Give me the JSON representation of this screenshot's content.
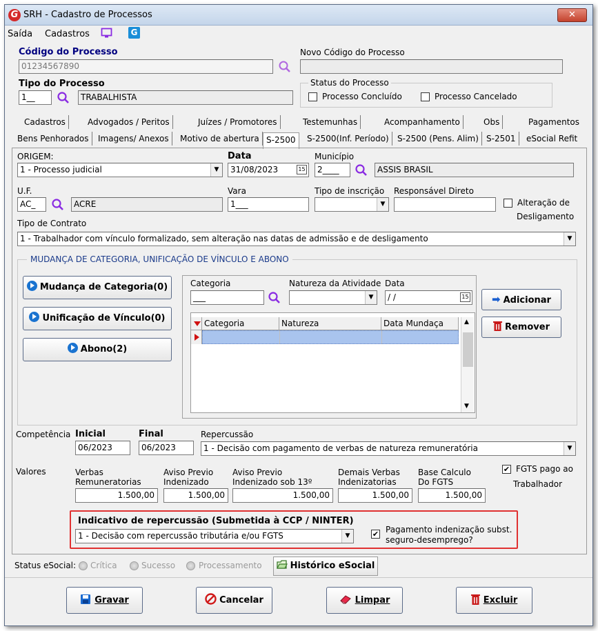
{
  "window": {
    "title": "SRH - Cadastro de Processos",
    "close_glyph": "✕",
    "logo_letter": "G"
  },
  "menu": {
    "saida": "Saída",
    "cadastros": "Cadastros",
    "icons": [
      "monitor-icon",
      "app-logo-icon"
    ]
  },
  "header": {
    "codigo_label": "Código do Processo",
    "codigo_value": "01234567890",
    "novo_codigo_label": "Novo Código do Processo",
    "novo_codigo_value": "",
    "tipo_label": "Tipo do Processo",
    "tipo_code": "1__",
    "tipo_desc": "TRABALHISTA",
    "status_label": "Status do Processo",
    "status_concluido": "Processo Concluído",
    "status_cancelado": "Processo Cancelado"
  },
  "tabs": {
    "row1": [
      "Cadastros",
      "Advogados / Peritos",
      "Juízes / Promotores",
      "Testemunhas",
      "Acompanhamento",
      "Obs",
      "Pagamentos"
    ],
    "row2": [
      "Bens Penhorados",
      "Imagens/ Anexos",
      "Motivo de abertura",
      "S-2500",
      "S-2500(Inf. Período)",
      "S-2500 (Pens. Alim)",
      "S-2501",
      "eSocial Refit"
    ],
    "active": "S-2500"
  },
  "s2500": {
    "origem_label": "ORIGEM:",
    "origem_value": "1 - Processo judicial",
    "data_label": "Data",
    "data_value": "31/08/2023",
    "municipio_label": "Município",
    "municipio_code": "2____",
    "municipio_name": "ASSIS BRASIL",
    "uf_label": "U.F.",
    "uf_code": "AC_",
    "uf_name": "ACRE",
    "vara_label": "Vara",
    "vara_value": "1___",
    "tipo_inscricao_label": "Tipo de inscrição",
    "tipo_inscricao_value": "",
    "responsavel_label": "Responsável Direto",
    "responsavel_value": "",
    "alteracao_label_1": "Alteração de",
    "alteracao_label_2": "Desligamento",
    "tipo_contrato_label": "Tipo de Contrato",
    "tipo_contrato_value": "1 - Trabalhador com vínculo formalizado, sem alteração nas datas de admissão e de desligamento",
    "calendar_glyph": "15"
  },
  "mudanca": {
    "group_title": "MUDANÇA DE CATEGORIA, UNIFICAÇÃO DE VÍNCULO E ABONO",
    "btn_mudanca": "Mudança de Categoria(0)",
    "btn_unificacao": "Unificação de Vínculo(0)",
    "btn_abono": "Abono(2)",
    "categoria_label": "Categoria",
    "categoria_value": "___",
    "natureza_label": "Natureza da Atividade",
    "natureza_value": "",
    "data_label": "Data",
    "data_value": " / /",
    "btn_adicionar": "Adicionar",
    "btn_remover": "Remover",
    "grid_columns": [
      "Categoria",
      "Natureza",
      "Data Mundaça"
    ]
  },
  "competencia": {
    "label": "Competência",
    "inicial_label": "Inicial",
    "inicial_value": "06/2023",
    "final_label": "Final",
    "final_value": "06/2023",
    "repercussao_label": "Repercussão",
    "repercussao_value": "1 - Decisão com pagamento de verbas de natureza remuneratória"
  },
  "valores": {
    "label": "Valores",
    "verbas_rem_label_1": "Verbas",
    "verbas_rem_label_2": "Remuneratorias",
    "verbas_rem_value": "1.500,00",
    "aviso_label_1": "Aviso Previo",
    "aviso_label_2": "Indenizado",
    "aviso_value": "1.500,00",
    "aviso13_label_1": "Aviso Previo",
    "aviso13_label_2": "Indenizado sob 13º",
    "aviso13_value": "1.500,00",
    "demais_label_1": "Demais Verbas",
    "demais_label_2": "Indenizatorias",
    "demais_value": "1.500,00",
    "base_label_1": "Base Calculo",
    "base_label_2": "Do FGTS",
    "base_value": "1.500,00",
    "fgts_label_1": "FGTS pago ao",
    "fgts_label_2": "Trabalhador",
    "fgts_checked": "✔"
  },
  "indicativo": {
    "label": "Indicativo de repercussão (Submetida à CCP / NINTER)",
    "value": "1 - Decisão com repercussão tributária e/ou FGTS",
    "pagamento_label_1": "Pagamento indenização subst.",
    "pagamento_label_2": "seguro-desemprego?",
    "pagamento_checked": "✔",
    "highlight_color": "#e03030"
  },
  "status_esocial": {
    "label": "Status eSocial:",
    "options": [
      "Crítica",
      "Sucesso",
      "Processamento"
    ],
    "historico_button": "Histórico eSocial"
  },
  "footer": {
    "gravar": "Gravar",
    "cancelar": "Cancelar",
    "limpar": "Limpar",
    "excluir": "Excluir"
  }
}
